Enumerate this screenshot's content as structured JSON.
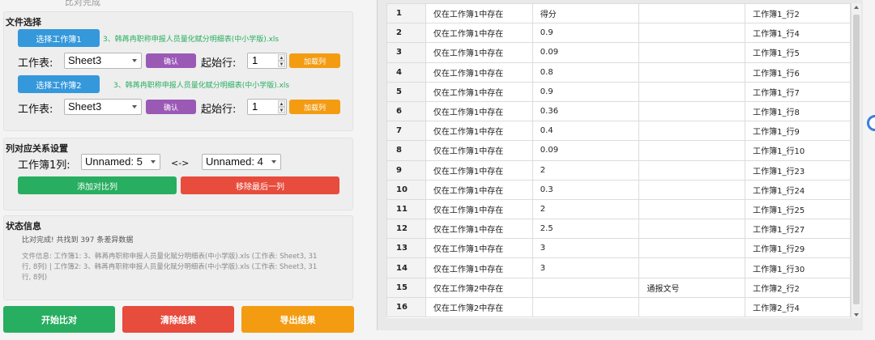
{
  "file_group": {
    "title": "文件选择",
    "cut_header_text": "比对完成",
    "file1": {
      "select_label": "选择工作簿1",
      "filename": "3、韩苒冉职称申报人员量化赋分明细表(中小学版).xls",
      "sheet_label": "工作表:",
      "sheet_value": "Sheet3",
      "confirm_label": "确认",
      "start_row_label": "起始行:",
      "start_row_value": "1",
      "load_label": "加载列"
    },
    "file2": {
      "select_label": "选择工作簿2",
      "filename": "3、韩苒冉职称申报人员量化赋分明细表(中小学版).xls",
      "sheet_label": "工作表:",
      "sheet_value": "Sheet3",
      "confirm_label": "确认",
      "start_row_label": "起始行:",
      "start_row_value": "1",
      "load_label": "加载列"
    }
  },
  "mapping_group": {
    "title": "列对应关系设置",
    "col_label": "工作簿1列:",
    "col1_value": "Unnamed: 5",
    "arrow_text": "<->",
    "col2_value": "Unnamed: 4",
    "add_label": "添加对比列",
    "remove_label": "移除最后一列"
  },
  "status_group": {
    "title": "状态信息",
    "message": "比对完成! 共找到 397 条差异数据",
    "info": "文件信息: 工作簿1: 3、韩苒冉职称申报人员量化赋分明细表(中小学版).xls (工作表: Sheet3, 31行, 8列) | 工作簿2: 3、韩苒冉职称申报人员量化赋分明细表(中小学版).xls (工作表: Sheet3, 31行, 8列)"
  },
  "actions": {
    "start_label": "开始比对",
    "clear_label": "清除结果",
    "export_label": "导出结果"
  },
  "colors": {
    "blue": "#3498db",
    "purple": "#9b59b6",
    "orange": "#f39c12",
    "green": "#27ae60",
    "red": "#e74c3c"
  },
  "results": {
    "rows": [
      {
        "n": "1",
        "status": "仅在工作簿1中存在",
        "v1": "得分",
        "v2": "",
        "loc": "工作簿1_行2"
      },
      {
        "n": "2",
        "status": "仅在工作簿1中存在",
        "v1": "0.9",
        "v2": "",
        "loc": "工作簿1_行4"
      },
      {
        "n": "3",
        "status": "仅在工作簿1中存在",
        "v1": "0.09",
        "v2": "",
        "loc": "工作簿1_行5"
      },
      {
        "n": "4",
        "status": "仅在工作簿1中存在",
        "v1": "0.8",
        "v2": "",
        "loc": "工作簿1_行6"
      },
      {
        "n": "5",
        "status": "仅在工作簿1中存在",
        "v1": "0.9",
        "v2": "",
        "loc": "工作簿1_行7"
      },
      {
        "n": "6",
        "status": "仅在工作簿1中存在",
        "v1": "0.36",
        "v2": "",
        "loc": "工作簿1_行8"
      },
      {
        "n": "7",
        "status": "仅在工作簿1中存在",
        "v1": "0.4",
        "v2": "",
        "loc": "工作簿1_行9"
      },
      {
        "n": "8",
        "status": "仅在工作簿1中存在",
        "v1": "0.09",
        "v2": "",
        "loc": "工作簿1_行10"
      },
      {
        "n": "9",
        "status": "仅在工作簿1中存在",
        "v1": "2",
        "v2": "",
        "loc": "工作簿1_行23"
      },
      {
        "n": "10",
        "status": "仅在工作簿1中存在",
        "v1": "0.3",
        "v2": "",
        "loc": "工作簿1_行24"
      },
      {
        "n": "11",
        "status": "仅在工作簿1中存在",
        "v1": "2",
        "v2": "",
        "loc": "工作簿1_行25"
      },
      {
        "n": "12",
        "status": "仅在工作簿1中存在",
        "v1": "2.5",
        "v2": "",
        "loc": "工作簿1_行27"
      },
      {
        "n": "13",
        "status": "仅在工作簿1中存在",
        "v1": "3",
        "v2": "",
        "loc": "工作簿1_行29"
      },
      {
        "n": "14",
        "status": "仅在工作簿1中存在",
        "v1": "3",
        "v2": "",
        "loc": "工作簿1_行30"
      },
      {
        "n": "15",
        "status": "仅在工作簿2中存在",
        "v1": "",
        "v2": "通报文号",
        "loc": "工作簿2_行2"
      },
      {
        "n": "16",
        "status": "仅在工作簿2中存在",
        "v1": "",
        "v2": "",
        "loc": "工作簿2_行4"
      }
    ]
  }
}
